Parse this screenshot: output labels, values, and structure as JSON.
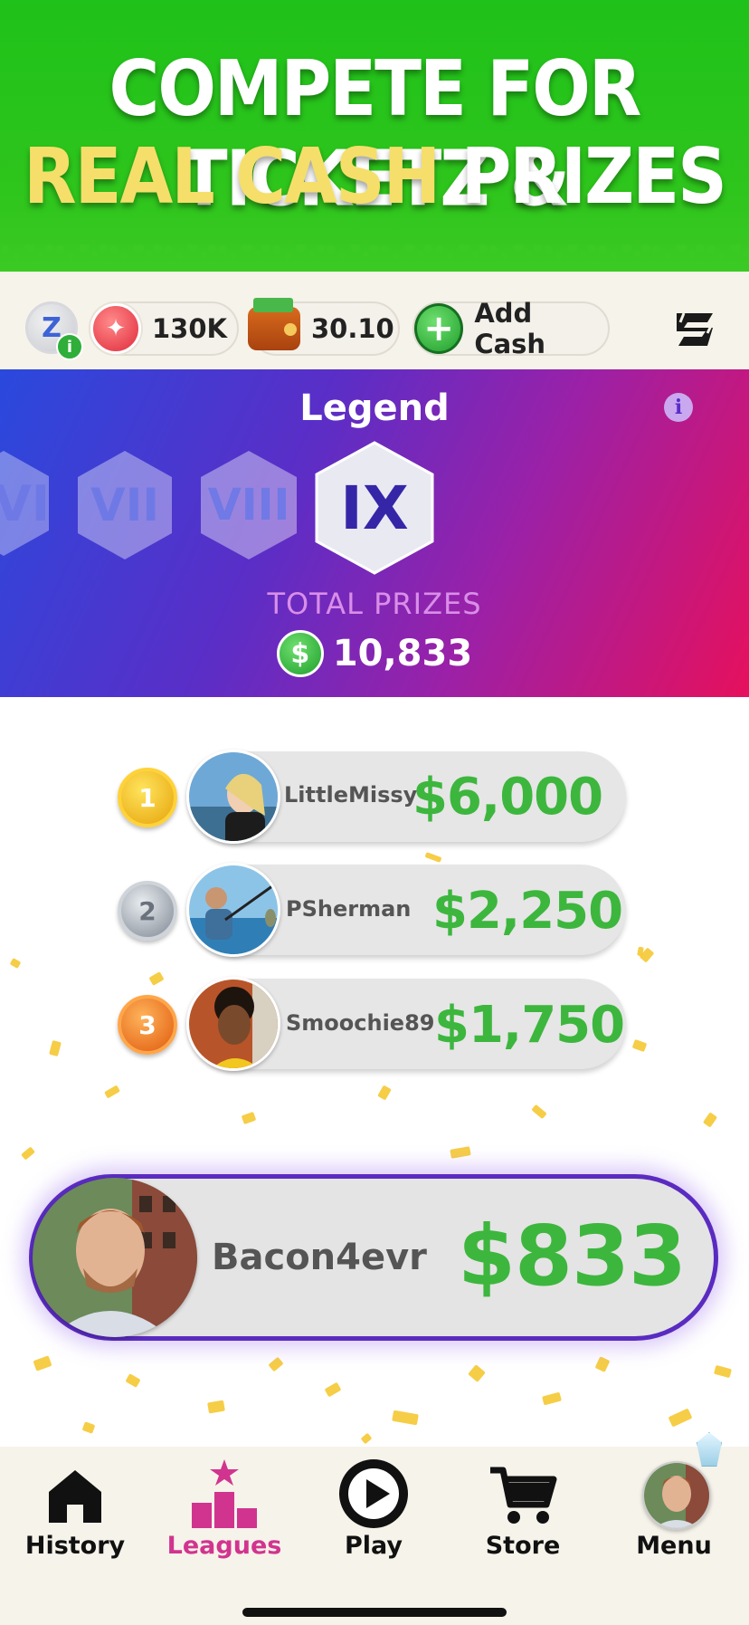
{
  "hero": {
    "line1": "COMPETE FOR TICKETZ &",
    "line2_gold": "REAL CASH",
    "line2_white": " PRIZES"
  },
  "status": {
    "level_badge": "Z",
    "info_label": "i",
    "tickets": "130K",
    "cash": "30.10",
    "add_cash": "Add Cash",
    "plus": "+"
  },
  "league": {
    "title": "Legend",
    "info": "i",
    "tiers": [
      "VI",
      "VII",
      "VIII",
      "IX"
    ],
    "current_tier": "IX",
    "total_prizes_label": "TOTAL PRIZES",
    "currency_symbol": "$",
    "total_prizes_value": "10,833"
  },
  "leaderboard": [
    {
      "rank": "1",
      "name": "LittleMissy",
      "prize": "$6,000"
    },
    {
      "rank": "2",
      "name": "PSherman",
      "prize": "$2,250"
    },
    {
      "rank": "3",
      "name": "Smoochie89",
      "prize": "$1,750"
    }
  ],
  "me": {
    "name": "Bacon4evr",
    "prize": "$833"
  },
  "nav": [
    {
      "label": "History",
      "icon": "home-icon",
      "active": false
    },
    {
      "label": "Leagues",
      "icon": "podium-icon",
      "active": true
    },
    {
      "label": "Play",
      "icon": "play-icon",
      "active": false
    },
    {
      "label": "Store",
      "icon": "cart-icon",
      "active": false
    },
    {
      "label": "Menu",
      "icon": "avatar",
      "active": false
    }
  ],
  "colors": {
    "hero_green": "#1fc21a",
    "gold_text": "#f5df6a",
    "prize_green": "#3db63e",
    "active_nav": "#d1348f",
    "me_border": "#5a2bc0"
  }
}
